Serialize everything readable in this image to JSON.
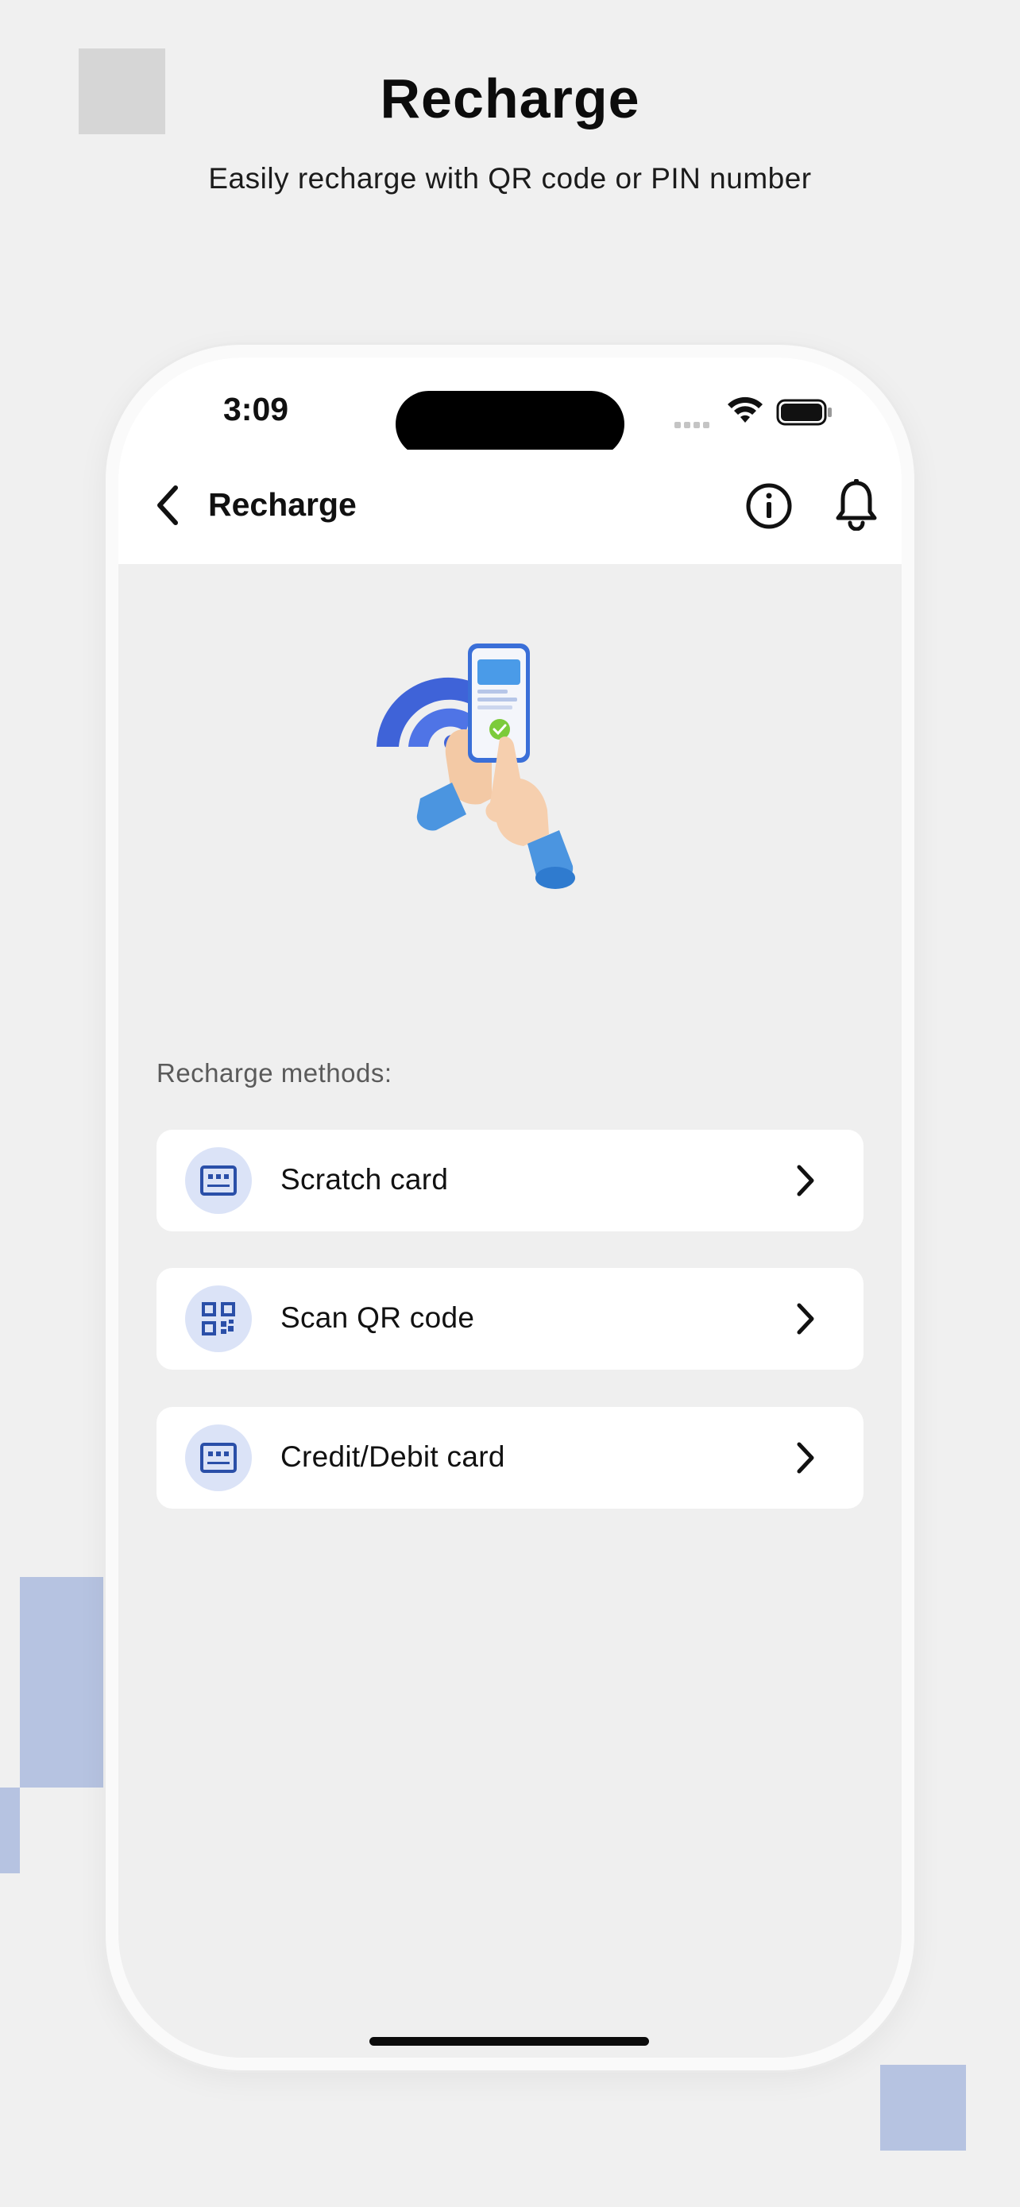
{
  "promo": {
    "title": "Recharge",
    "subtitle": "Easily recharge with QR code or PIN number"
  },
  "status_bar": {
    "time": "3:09"
  },
  "navbar": {
    "title": "Recharge"
  },
  "content": {
    "section_label": "Recharge methods:",
    "methods": [
      {
        "label": "Scratch card",
        "icon": "scratch-card-icon"
      },
      {
        "label": "Scan QR code",
        "icon": "qr-code-icon"
      },
      {
        "label": "Credit/Debit card",
        "icon": "card-icon"
      }
    ]
  },
  "colors": {
    "accent_blue": "#2a4fa8",
    "icon_circle": "#dbe3f7",
    "deco_blue": "#b6c3e1",
    "background": "#f0f0f0"
  }
}
